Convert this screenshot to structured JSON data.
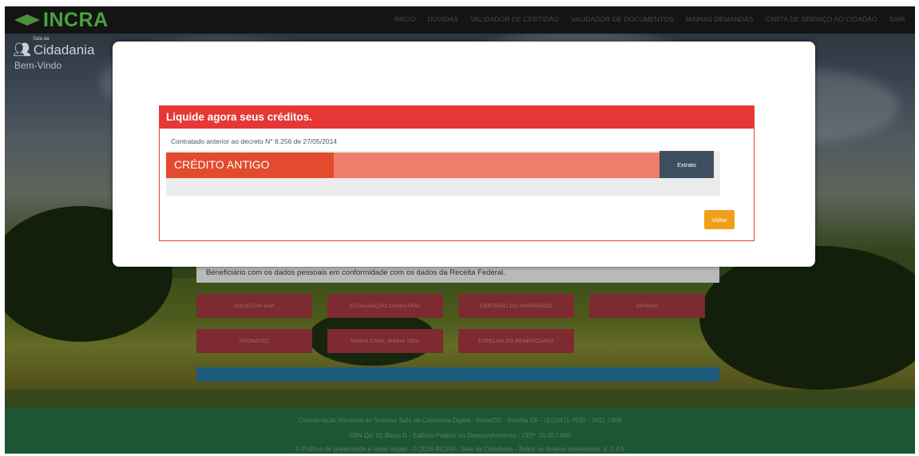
{
  "navbar": {
    "logo_text": "INCRA",
    "items": [
      "INÍCIO",
      "DÚVIDAS",
      "VALIDADOR DE CERTIDÃO",
      "VALIDADOR DE DOCUMENTOS",
      "MINHAS DEMANDAS",
      "CARTA DE SERVIÇO AO CIDADÃO",
      "SAIR"
    ]
  },
  "brand": {
    "sala_small": "Sala da",
    "sala_text": "Cidadania",
    "welcome": "Bem-Vindo"
  },
  "modal": {
    "title": "Liquide agora seus créditos.",
    "subtitle": "Contratado anterior ao decreto N° 8.256 de 27/05/2014",
    "credit_label": "CRÉDITO ANTIGO",
    "credit_progress": 0.34,
    "extrato_button": "Extrato",
    "voltar_button": "Voltar"
  },
  "background_page": {
    "status_text": "Beneficiário com os dados pessoais em conformidade com os dados da Receita Federal.",
    "tiles": [
      "SOLICITAR DAP",
      "ATUALIZAÇÃO CADASTRAL",
      "CERTIDÃO DO ASSENTADO",
      "DÍVIDAS",
      "PRONATEC",
      "MINHA CASA, MINHA VIDA",
      "ESPELHO DO BENEFICIÁRIO"
    ]
  },
  "footer": {
    "line1": "Coordenação Nacional do Sistema Sala da Cidadania Digital - Incra/DD - Brasília DF - (61)3411-7620 - 3411-7498",
    "line2": "SBN Qd. 01 Bloco D - Edifício Palácio do Desenvolvimento - CEP: 70.057-900",
    "line3": "© Política de privacidade e notas legais - © 2016 INCRA - Sala da Cidadania - Todos os direitos reservados. V. 2.4.5"
  },
  "colors": {
    "header_red": "#e53735",
    "credit_fill": "#e24b2d",
    "credit_track": "#f07e6d",
    "extrato_bg": "#3d4e5f",
    "voltar_bg": "#f0a018",
    "footer_bg": "#1c5635",
    "logo_green": "#4aa23f"
  },
  "icons": {
    "logo": "incra-logo-icon",
    "sala": "people-icon"
  }
}
